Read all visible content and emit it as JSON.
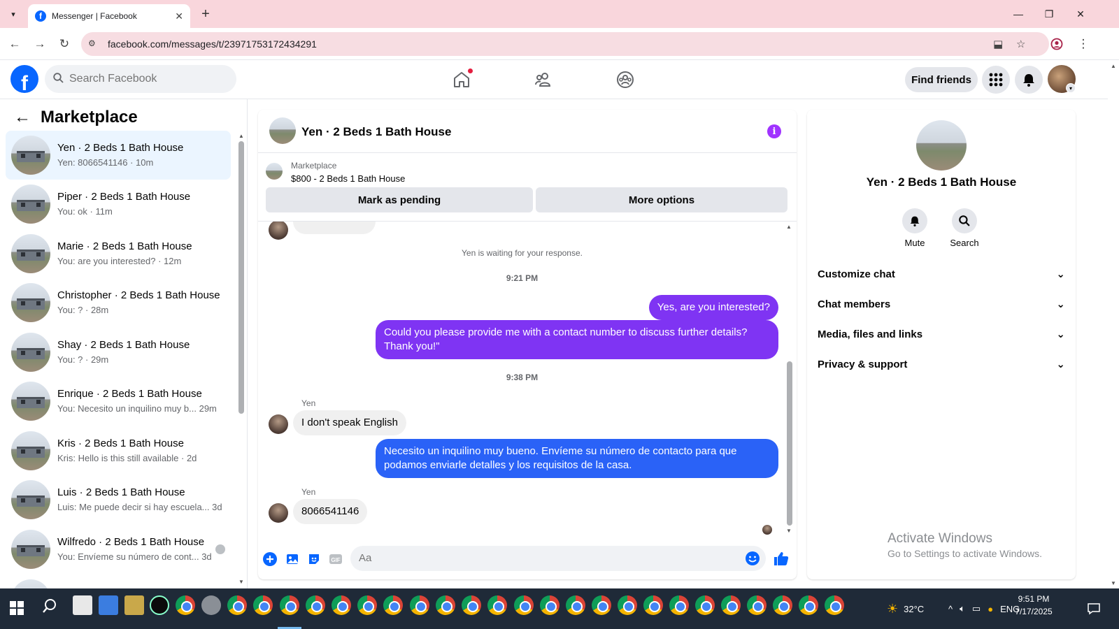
{
  "browser": {
    "tab_title": "Messenger | Facebook",
    "url": "facebook.com/messages/t/23971753172434291"
  },
  "header": {
    "search_placeholder": "Search Facebook",
    "find_friends": "Find friends"
  },
  "left_panel": {
    "title": "Marketplace",
    "conversations": [
      {
        "name": "Yen · 2 Beds 1 Bath House",
        "sub": "Yen: 8066541146 · 10m",
        "active": true
      },
      {
        "name": "Piper · 2 Beds 1 Bath House",
        "sub": "You: ok · 11m"
      },
      {
        "name": "Marie · 2 Beds 1 Bath House",
        "sub": "You: are you interested? · 12m"
      },
      {
        "name": "Christopher · 2 Beds 1 Bath House",
        "sub": "You: ? · 28m"
      },
      {
        "name": "Shay · 2 Beds 1 Bath House",
        "sub": "You: ? · 29m"
      },
      {
        "name": "Enrique · 2 Beds 1 Bath House",
        "sub": "You: Necesito un inquilino muy b...  29m"
      },
      {
        "name": "Kris · 2 Beds 1 Bath House",
        "sub": "Kris: Hello is this still available · 2d"
      },
      {
        "name": "Luis · 2 Beds 1 Bath House",
        "sub": "Luis: Me puede decir si hay escuela...  3d"
      },
      {
        "name": "Wilfredo · 2 Beds 1 Bath House",
        "sub": "You: Envíeme su número de cont...  3d"
      }
    ]
  },
  "chat": {
    "title": "Yen · 2 Beds 1 Bath House",
    "marketplace_label": "Marketplace",
    "listing": "$800 - 2 Beds 1 Bath House",
    "mark_pending": "Mark as pending",
    "more_options": "More options",
    "waiting": "Yen is waiting for your response.",
    "time1": "9:21 PM",
    "out1": "Yes, are you interested?",
    "out2": "Could you please provide me with a contact number to discuss further details? Thank you!\"",
    "time2": "9:38 PM",
    "sender": "Yen",
    "in1": "I don't speak English",
    "out3": "Necesito un inquilino muy bueno. Envíeme su número de contacto para que podamos enviarle detalles y los requisitos de la casa.",
    "in2": "8066541146",
    "composer_placeholder": "Aa",
    "colors": {
      "purple": "#7f34f3",
      "blue": "#2a62f7",
      "accent": "#0866ff"
    }
  },
  "right_panel": {
    "name": "Yen · 2 Beds 1 Bath House",
    "mute": "Mute",
    "search": "Search",
    "sections": [
      "Customize chat",
      "Chat members",
      "Media, files and links",
      "Privacy & support"
    ]
  },
  "watermark": {
    "line1": "Activate Windows",
    "line2": "Go to Settings to activate Windows."
  },
  "taskbar": {
    "weather": "32°C",
    "lang": "ENG",
    "time": "9:51 PM",
    "date": "7/17/2025"
  }
}
